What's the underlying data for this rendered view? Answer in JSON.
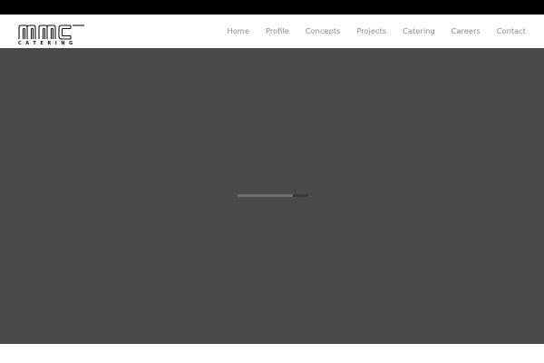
{
  "brand": {
    "logo_text": "mmc",
    "logo_subtitle": "CATERING",
    "logo_icon": "mmc-catering-logo"
  },
  "nav": {
    "items": [
      {
        "label": "Home"
      },
      {
        "label": "Profile"
      },
      {
        "label": "Concepts"
      },
      {
        "label": "Projects"
      },
      {
        "label": "Catering"
      },
      {
        "label": "Careers"
      },
      {
        "label": "Contact"
      }
    ]
  },
  "loader": {
    "progress": 0.78
  },
  "colors": {
    "topbar": "#000000",
    "header_bg": "#ffffff",
    "nav_text": "#8a8a8a",
    "main_bg": "#4a4a4a",
    "loader_track": "#3a3a3a",
    "loader_fill": "#6e6e6e"
  }
}
